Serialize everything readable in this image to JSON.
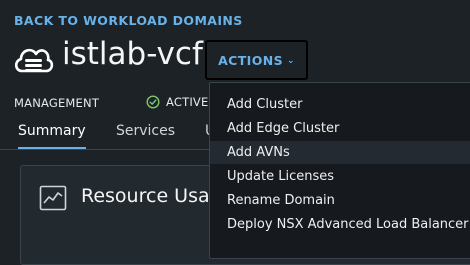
{
  "header": {
    "back_link": "BACK TO WORKLOAD DOMAINS",
    "title": "istlab-vcf",
    "domain_icon": "cloud-icon",
    "actions_label": "ACTIONS"
  },
  "meta": {
    "type": "MANAGEMENT",
    "status": "ACTIVE",
    "status_icon": "check-circle-icon",
    "status_color": "#7ec66e"
  },
  "tabs": [
    {
      "label": "Summary",
      "active": true
    },
    {
      "label": "Services"
    },
    {
      "label": "U"
    }
  ],
  "card": {
    "title": "Resource Usa",
    "icon": "chart-icon"
  },
  "actions_menu": {
    "items": [
      {
        "label": "Add Cluster"
      },
      {
        "label": "Add Edge Cluster"
      },
      {
        "label": "Add AVNs",
        "highlighted": true
      },
      {
        "label": "Update Licenses"
      },
      {
        "label": "Rename Domain"
      },
      {
        "label": "Deploy NSX Advanced Load Balancer"
      }
    ]
  },
  "colors": {
    "accent": "#69b2e8",
    "background": "#1d2227",
    "menu_background": "#161a1e"
  }
}
